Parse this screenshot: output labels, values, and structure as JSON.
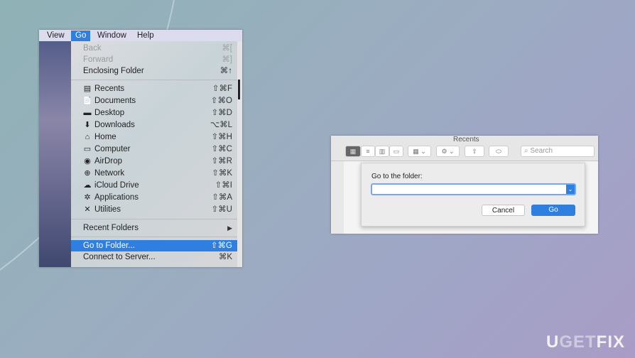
{
  "menubar": {
    "items": [
      "View",
      "Go",
      "Window",
      "Help"
    ]
  },
  "go_menu": {
    "group1": [
      {
        "label": "Back",
        "shortcut": "⌘[",
        "disabled": true
      },
      {
        "label": "Forward",
        "shortcut": "⌘]",
        "disabled": true
      },
      {
        "label": "Enclosing Folder",
        "shortcut": "⌘↑"
      }
    ],
    "group2": [
      {
        "label": "Recents",
        "shortcut": "⇧⌘F",
        "icon": "recents-icon",
        "glyph": "▤"
      },
      {
        "label": "Documents",
        "shortcut": "⇧⌘O",
        "icon": "documents-icon",
        "glyph": "📄"
      },
      {
        "label": "Desktop",
        "shortcut": "⇧⌘D",
        "icon": "desktop-icon",
        "glyph": "▬"
      },
      {
        "label": "Downloads",
        "shortcut": "⌥⌘L",
        "icon": "downloads-icon",
        "glyph": "⬇"
      },
      {
        "label": "Home",
        "shortcut": "⇧⌘H",
        "icon": "home-icon",
        "glyph": "⌂"
      },
      {
        "label": "Computer",
        "shortcut": "⇧⌘C",
        "icon": "computer-icon",
        "glyph": "▭"
      },
      {
        "label": "AirDrop",
        "shortcut": "⇧⌘R",
        "icon": "airdrop-icon",
        "glyph": "◉"
      },
      {
        "label": "Network",
        "shortcut": "⇧⌘K",
        "icon": "network-icon",
        "glyph": "⊕"
      },
      {
        "label": "iCloud Drive",
        "shortcut": "⇧⌘I",
        "icon": "icloud-icon",
        "glyph": "☁"
      },
      {
        "label": "Applications",
        "shortcut": "⇧⌘A",
        "icon": "applications-icon",
        "glyph": "✲"
      },
      {
        "label": "Utilities",
        "shortcut": "⇧⌘U",
        "icon": "utilities-icon",
        "glyph": "✕"
      }
    ],
    "recent_folders": "Recent Folders",
    "submenu_arrow": "▶",
    "go_to_folder": {
      "label": "Go to Folder...",
      "shortcut": "⇧⌘G"
    },
    "connect": {
      "label": "Connect to Server...",
      "shortcut": "⌘K"
    }
  },
  "finder": {
    "title": "Recents",
    "search_placeholder": "Search"
  },
  "dialog": {
    "prompt": "Go to the folder:",
    "value": "",
    "cancel": "Cancel",
    "go": "Go"
  },
  "watermark": {
    "a": "U",
    "b": "GET",
    "c": "FIX"
  },
  "colors": {
    "accent": "#2f7fe0"
  }
}
